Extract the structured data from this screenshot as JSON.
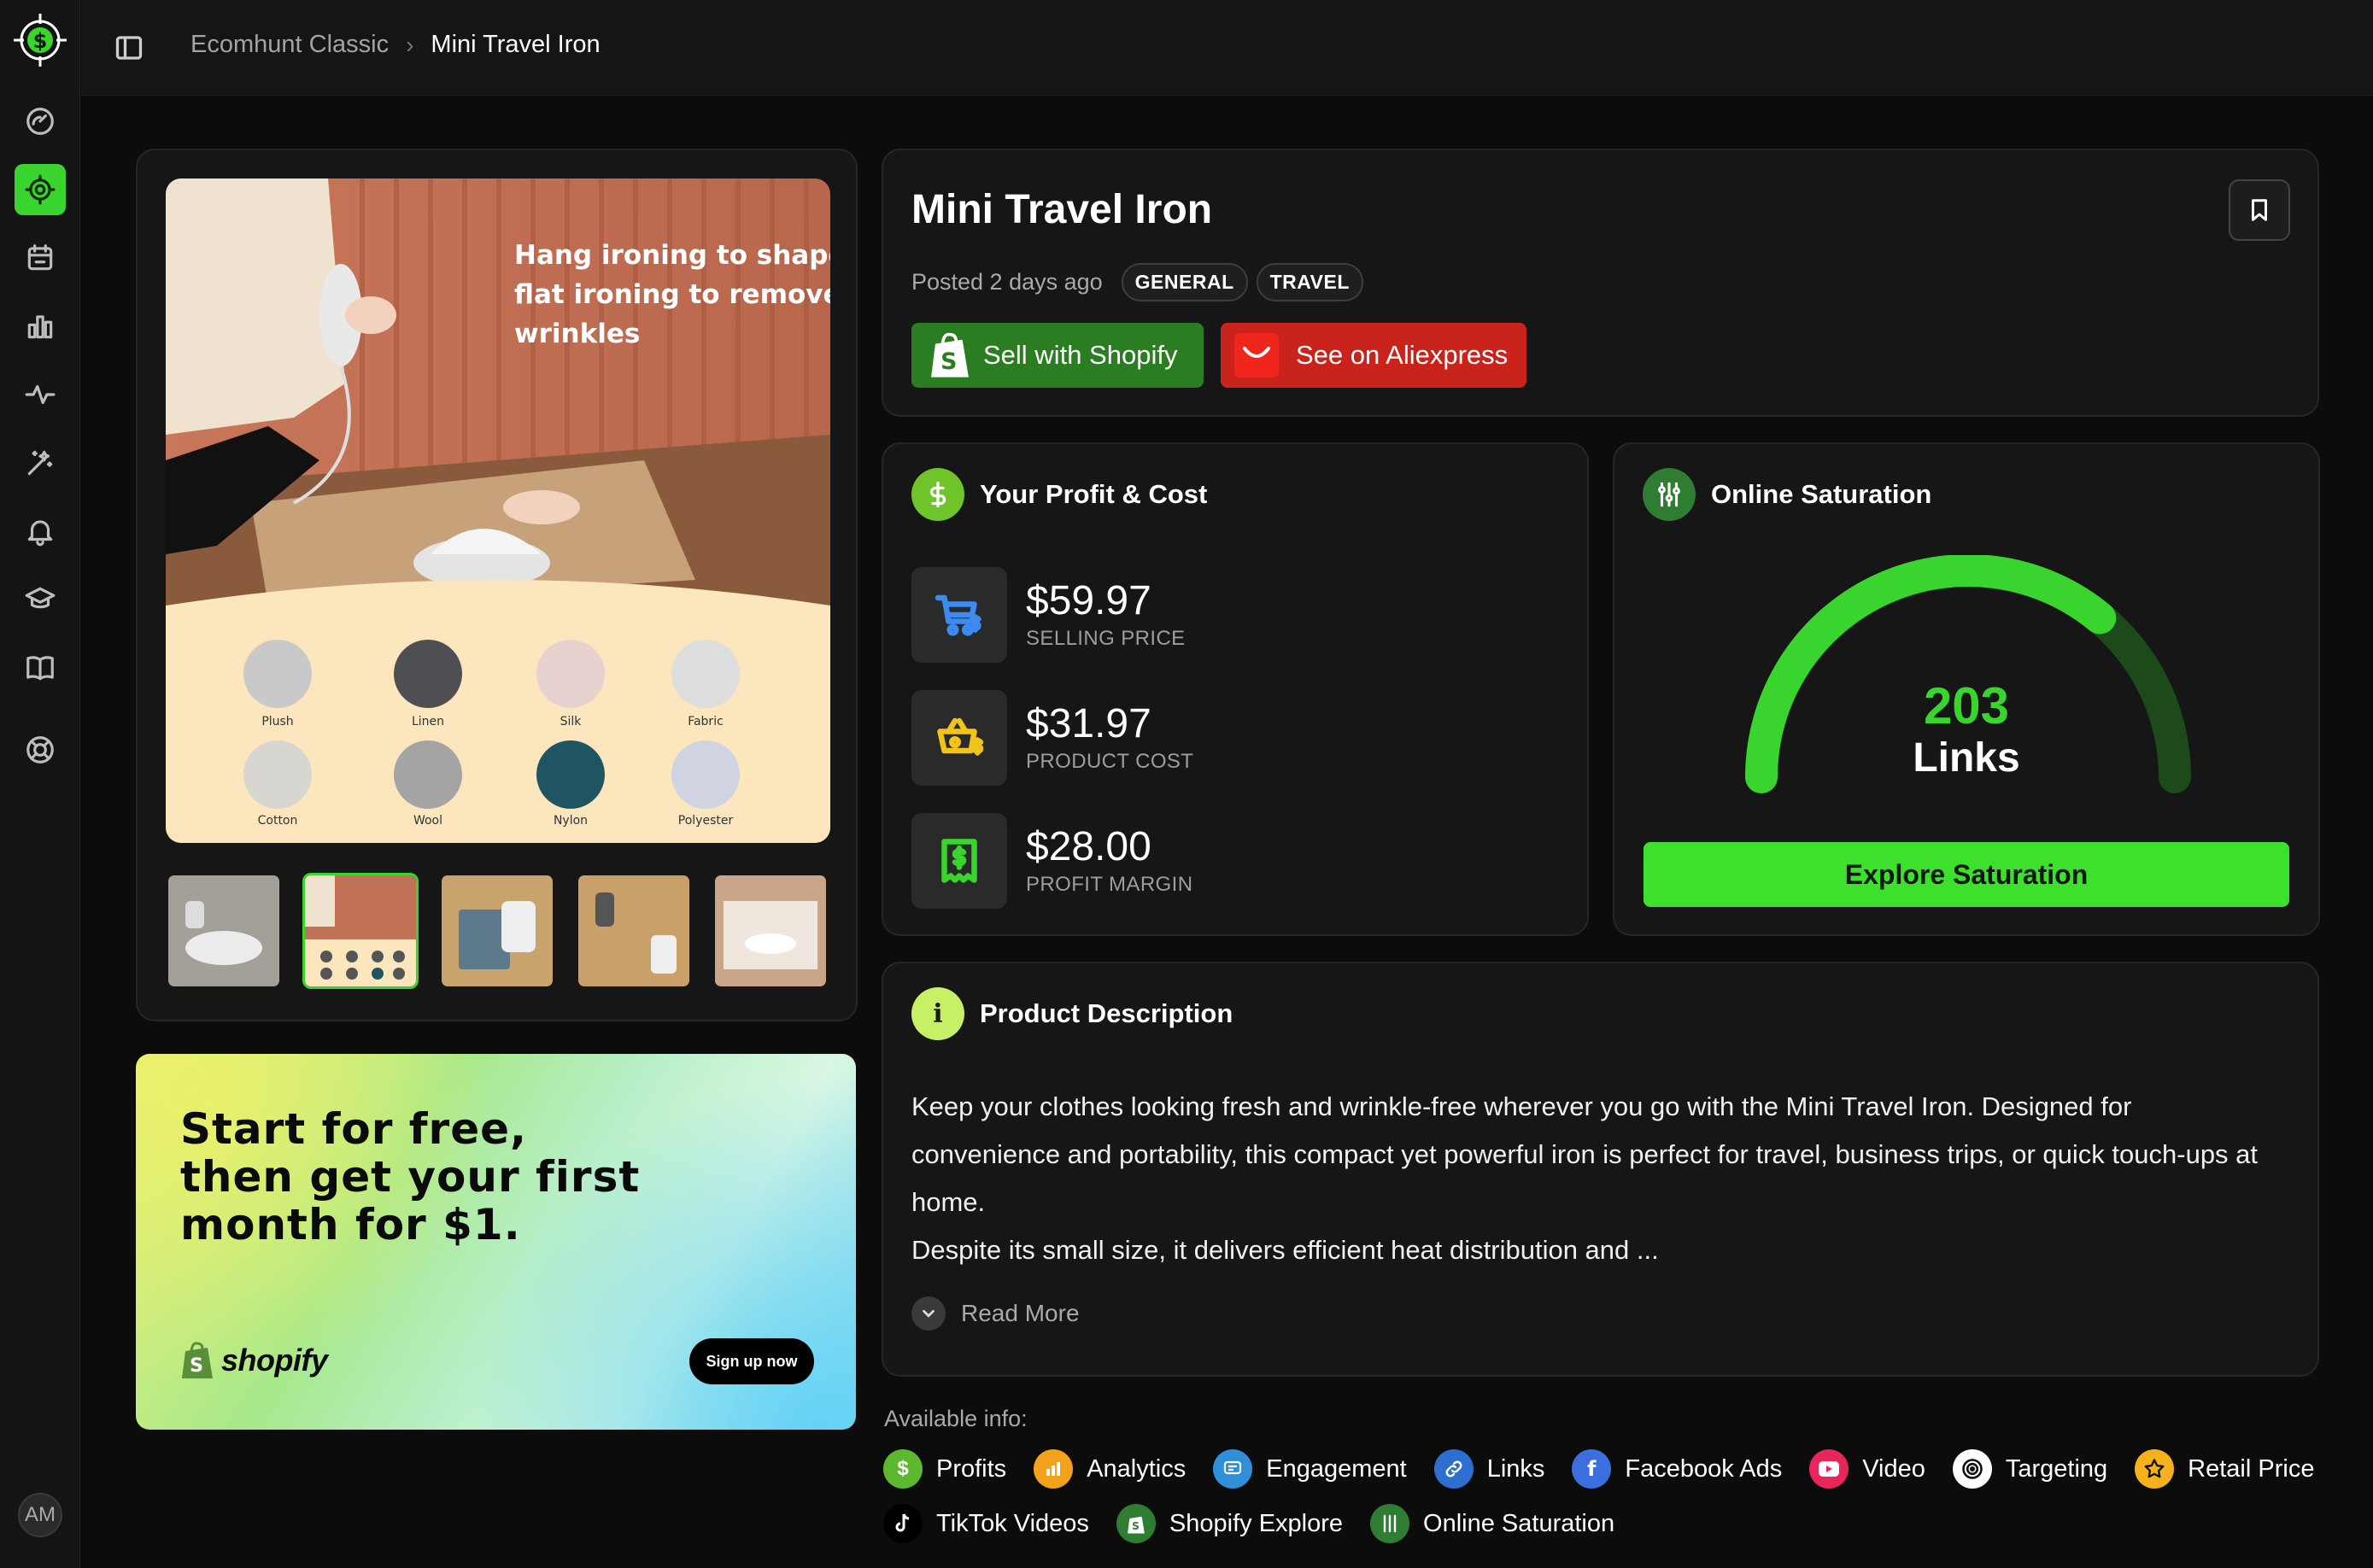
{
  "header": {
    "breadcrumb_parent": "Ecomhunt Classic",
    "breadcrumb_separator": "›",
    "breadcrumb_current": "Mini Travel Iron"
  },
  "sidebar": {
    "items": [
      {
        "icon": "dashboard-gauge-icon",
        "active": false
      },
      {
        "icon": "target-icon",
        "active": true
      },
      {
        "icon": "calendar-icon",
        "active": false
      },
      {
        "icon": "bar-chart-icon",
        "active": false
      },
      {
        "icon": "activity-icon",
        "active": false
      },
      {
        "icon": "magic-wand-icon",
        "active": false
      },
      {
        "icon": "bell-icon",
        "active": false
      },
      {
        "icon": "graduation-cap-icon",
        "active": false
      },
      {
        "icon": "book-icon",
        "active": false
      },
      {
        "icon": "lifebuoy-icon",
        "active": false
      }
    ],
    "avatar_initials": "AM"
  },
  "gallery": {
    "main_image_caption": "Hang ironing to shape,\nflat ironing to remove\nwrinkles",
    "fabrics": [
      "Plush",
      "Linen",
      "Silk",
      "Fabric",
      "Cotton",
      "Wool",
      "Nylon",
      "Polyester"
    ],
    "thumbnail_count": 5,
    "active_thumbnail": 1
  },
  "promo": {
    "title": "Start for free,\nthen get your first\nmonth for $1.",
    "brand": "shopify",
    "cta": "Sign up now"
  },
  "product": {
    "title": "Mini Travel Iron",
    "posted": "Posted 2 days ago",
    "tags": [
      "GENERAL",
      "TRAVEL"
    ],
    "sell_button": "Sell with Shopify",
    "aliexpress_button": "See on Aliexpress"
  },
  "profit": {
    "heading": "Your Profit & Cost",
    "metrics": [
      {
        "value": "$59.97",
        "label": "SELLING PRICE",
        "icon": "cart-dollar-icon"
      },
      {
        "value": "$31.97",
        "label": "PRODUCT COST",
        "icon": "basket-dollar-icon"
      },
      {
        "value": "$28.00",
        "label": "PROFIT MARGIN",
        "icon": "receipt-dollar-icon"
      }
    ]
  },
  "saturation": {
    "heading": "Online Saturation",
    "value": "203",
    "unit": "Links",
    "gauge_fill": 0.72,
    "button": "Explore Saturation"
  },
  "description": {
    "heading": "Product Description",
    "text": "Keep your clothes looking fresh and wrinkle-free wherever you go with the Mini Travel Iron. Designed for convenience and portability, this compact yet powerful iron is perfect for travel, business trips, or quick touch-ups at home.",
    "text2": "Despite its small size, it delivers efficient heat distribution and ...",
    "read_more": "Read More"
  },
  "available": {
    "title": "Available info:",
    "items": [
      {
        "label": "Profits",
        "icon": "dollar-icon",
        "color": "#5cb82e"
      },
      {
        "label": "Analytics",
        "icon": "analytics-icon",
        "color": "#f2a21b"
      },
      {
        "label": "Engagement",
        "icon": "engagement-icon",
        "color": "#2f8fd8"
      },
      {
        "label": "Links",
        "icon": "link-icon",
        "color": "#2d6fd1"
      },
      {
        "label": "Facebook Ads",
        "icon": "facebook-icon",
        "color": "#3b6fe0"
      },
      {
        "label": "Video",
        "icon": "youtube-icon",
        "color": "#e8265a"
      },
      {
        "label": "Targeting",
        "icon": "target-icon",
        "color": "#ffffff"
      },
      {
        "label": "Retail Price",
        "icon": "star-icon",
        "color": "#f5b21c"
      },
      {
        "label": "TikTok Videos",
        "icon": "tiktok-icon",
        "color": "#000000"
      },
      {
        "label": "Shopify Explore",
        "icon": "shopify-icon",
        "color": "#2e7d32"
      },
      {
        "label": "Online Saturation",
        "icon": "saturation-icon",
        "color": "#2e7d32"
      }
    ]
  },
  "colors": {
    "accent": "#39d42e",
    "shopify_green": "#2b7d21",
    "aliexpress_red": "#c9231c"
  }
}
